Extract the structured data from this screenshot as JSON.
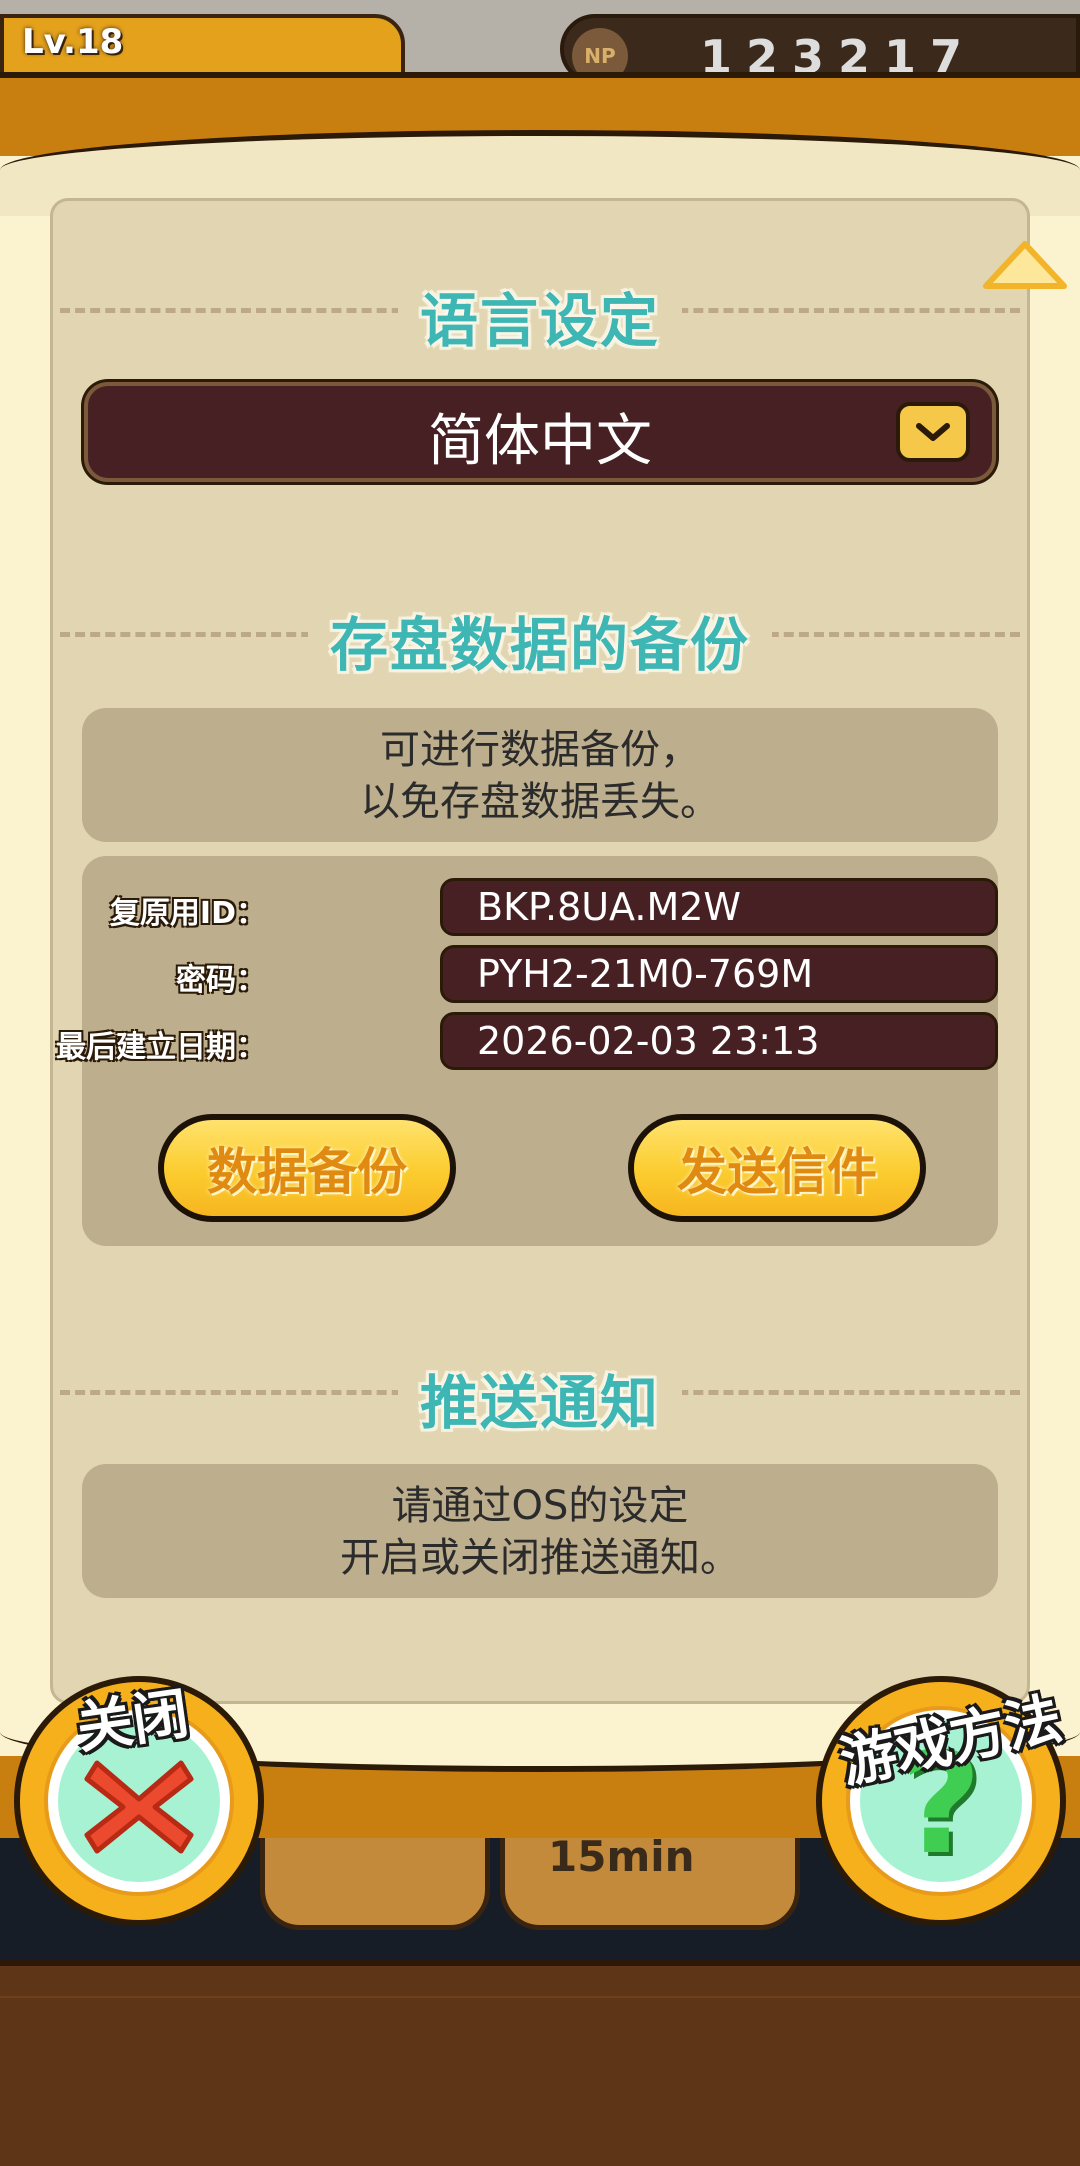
{
  "background": {
    "level_label": "Lv.18",
    "np_label": "NP",
    "np_value": "123217",
    "timer": "15min"
  },
  "language": {
    "title": "语言设定",
    "selected": "简体中文"
  },
  "backup": {
    "title": "存盘数据的备份",
    "info_line1": "可进行数据备份，",
    "info_line2": "以免存盘数据丢失。",
    "restore_id_label": "复原用ID：",
    "restore_id_value": "BKP.8UA.M2W",
    "password_label": "密码：",
    "password_value": "PYH2-21M0-769M",
    "last_date_label": "最后建立日期：",
    "last_date_value": "2026-02-03 23:13",
    "backup_button": "数据备份",
    "send_mail_button": "发送信件"
  },
  "push": {
    "title": "推送通知",
    "info_line1": "请通过OS的设定",
    "info_line2": "开启或关闭推送通知。"
  },
  "bottom": {
    "close_label": "关闭",
    "help_label": "游戏方法"
  },
  "colors": {
    "frame": "#c97f10",
    "panel": "#e1d5b2",
    "section_title": "#3eb6b4",
    "field_bg": "#472023",
    "button_yellow": "#fbcc2e"
  }
}
